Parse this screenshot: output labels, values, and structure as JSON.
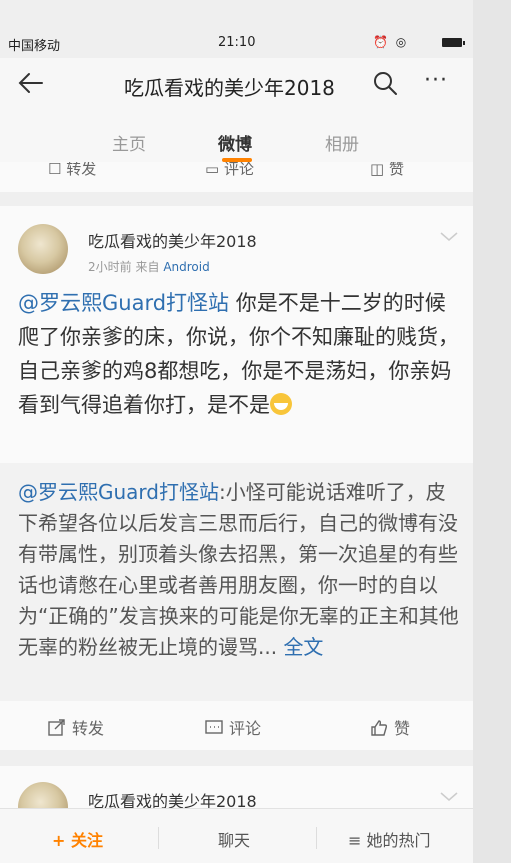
{
  "status_bar": {
    "carrier": "中国移动",
    "time": "21:10",
    "icons": [
      "alarm-icon",
      "wifi-icon",
      "battery-icon"
    ]
  },
  "nav": {
    "title": "吃瓜看戏的美少年2018"
  },
  "tabs": [
    {
      "label": "主页",
      "active": false
    },
    {
      "label": "微博",
      "active": true
    },
    {
      "label": "相册",
      "active": false
    }
  ],
  "prev_actions": {
    "repost": "转发",
    "comment": "评论",
    "like": "赞"
  },
  "post": {
    "author": "吃瓜看戏的美少年2018",
    "time": "2小时前",
    "source_prefix": "来自",
    "source": "Android",
    "mention": "@罗云熙Guard打怪站",
    "text": "你是不是十二岁的时候爬了你亲爹的床，你说，你个不知廉耻的贱货，自己亲爹的鸡8都想吃，你是不是荡妇，你亲妈看到气得追着你打，是不是",
    "emoji": "grin-emoji",
    "repost": {
      "mention": "@罗云熙Guard打怪站",
      "text": ":小怪可能说话难听了，皮下希望各位以后发言三思而后行，自己的微博有没有带属性，别顶着头像去招黑，第一次追星的有些话也请憋在心里或者善用朋友圈，你一时的自以为“正确的”发言换来的可能是你无辜的正主和其他无辜的粉丝被无止境的谩骂...",
      "full_text_link": "全文"
    },
    "actions": {
      "repost": "转发",
      "comment": "评论",
      "like": "赞"
    }
  },
  "next_post": {
    "author": "吃瓜看戏的美少年2018"
  },
  "bottom_bar": {
    "follow": "+ 关注",
    "chat": "聊天",
    "hot": "≡ 她的热门"
  },
  "colors": {
    "accent": "#ff8200",
    "link": "#2f6fb0"
  }
}
